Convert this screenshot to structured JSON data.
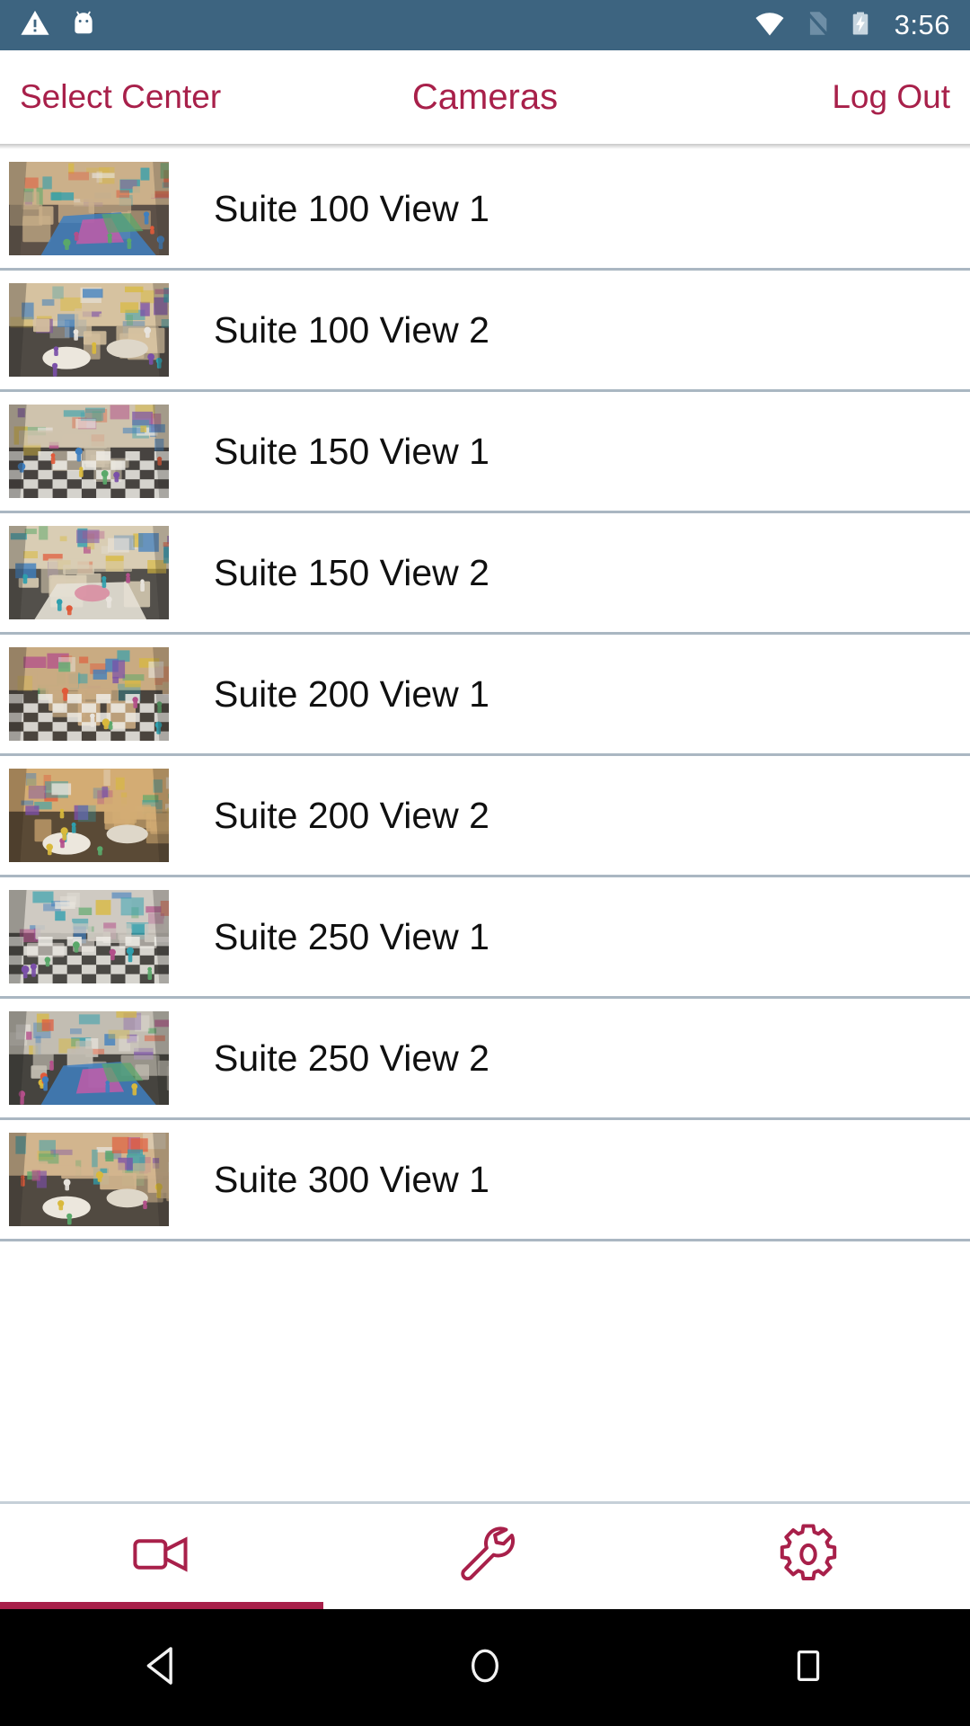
{
  "statusbar": {
    "background": "#3d6480",
    "clock": "3:56",
    "icons": [
      {
        "name": "warning-triangle-icon",
        "label": "Warning"
      },
      {
        "name": "android-bugdroid-icon",
        "label": "Android"
      },
      {
        "name": "wifi-icon",
        "label": "Wi-Fi connected"
      },
      {
        "name": "no-sim-icon",
        "label": "No SIM"
      },
      {
        "name": "battery-charging-icon",
        "label": "Battery charging"
      }
    ]
  },
  "navbar": {
    "left_button": "Select Center",
    "title": "Cameras",
    "right_button": "Log Out",
    "accent_color": "#a8204a"
  },
  "list": {
    "divider_color": "#aab7c2",
    "items": [
      {
        "label": "Suite 100 View 1",
        "thumb": "classroom-wide-rug"
      },
      {
        "label": "Suite 100 View 2",
        "thumb": "classroom-tables-window"
      },
      {
        "label": "Suite 150 View 1",
        "thumb": "classroom-checker-floor"
      },
      {
        "label": "Suite 150 View 2",
        "thumb": "classroom-blue-tables"
      },
      {
        "label": "Suite 200 View 1",
        "thumb": "classroom-ball-checker"
      },
      {
        "label": "Suite 200 View 2",
        "thumb": "classroom-wood-shelves"
      },
      {
        "label": "Suite 250 View 1",
        "thumb": "classroom-checker-hall"
      },
      {
        "label": "Suite 250 View 2",
        "thumb": "classroom-blue-circle-rug"
      },
      {
        "label": "Suite 300 View 1",
        "thumb": "classroom-round-tables"
      }
    ]
  },
  "tabbar": {
    "accent_color": "#a8204a",
    "active_index": 0,
    "tabs": [
      {
        "name": "tab-cameras",
        "icon": "video-camera-icon",
        "label": "Cameras"
      },
      {
        "name": "tab-tools",
        "icon": "wrench-icon",
        "label": "Tools"
      },
      {
        "name": "tab-settings",
        "icon": "gear-icon",
        "label": "Settings"
      }
    ]
  },
  "sysnav": {
    "background": "#000000",
    "buttons": [
      {
        "name": "android-back-button",
        "icon": "triangle-back-icon"
      },
      {
        "name": "android-home-button",
        "icon": "circle-home-icon"
      },
      {
        "name": "android-recents-button",
        "icon": "square-recents-icon"
      }
    ]
  }
}
